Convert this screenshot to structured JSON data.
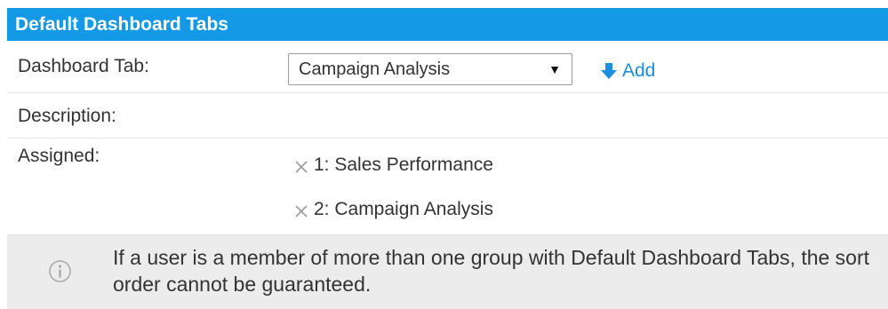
{
  "header": {
    "title": "Default Dashboard Tabs"
  },
  "form": {
    "tab_label": "Dashboard Tab:",
    "tab_select_value": "Campaign Analysis",
    "add_label": "Add",
    "description_label": "Description:",
    "assigned_label": "Assigned:"
  },
  "assigned": [
    {
      "label": "1: Sales Performance"
    },
    {
      "label": "2: Campaign Analysis"
    }
  ],
  "note": {
    "text": "If a user is a member of more than one group with Default Dashboard Tabs, the sort order cannot be guaranteed."
  },
  "icons": {
    "select_arrow": "triangle-down-icon",
    "add": "arrow-down-icon",
    "remove": "x-icon",
    "info": "info-icon"
  },
  "colors": {
    "header_bg": "#1399e6",
    "accent": "#1c8ee0",
    "note_bg": "#ececec"
  }
}
